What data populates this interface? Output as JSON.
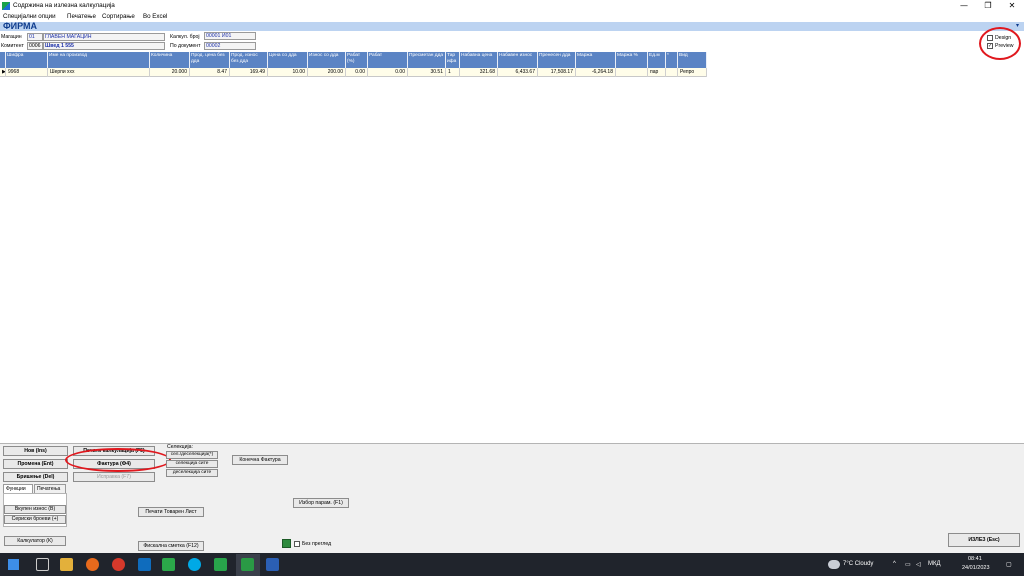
{
  "window": {
    "title": "Содржина на излезна калкулација",
    "controls": {
      "minimize": "—",
      "restore": "❐",
      "close": "✕"
    }
  },
  "menu": [
    "Специјални опции",
    "Печатење",
    "Сортирање",
    "Во Excel"
  ],
  "header": {
    "title": "ФИРМА",
    "magacin_label": "Магацин",
    "magacin_code": "01",
    "magacin_name": "ГЛАВЕН МАГАЦИН",
    "komintent_label": "Комитент",
    "komintent_code": "0006",
    "komintent_name": "Швед 1 555",
    "kalkul_label": "Калкул. број",
    "kalkul_value": "00001 И01",
    "podok_label": "По документ",
    "podok_value": "00002",
    "design_label": "Design",
    "design_checked": false,
    "preview_label": "Preview",
    "preview_checked": true
  },
  "grid": {
    "columns": [
      "Шифра",
      "Име на производ",
      "Количина",
      "Прод. цена без дда",
      "Прод. износ без дда",
      "Цена со дда",
      "Износ со дда",
      "Рабат (%)",
      "Рабат",
      "Пресметан дда",
      "Тар ифа",
      "Набавна цена",
      "Набавен износ",
      "Пренесен дда",
      "Маржа",
      "Маржа %",
      "Ед.м",
      "*",
      "Вид"
    ],
    "rows": [
      [
        "9968",
        "Шерпи ххх",
        "20.000",
        "8.47",
        "169.49",
        "10.00",
        "200.00",
        "0.00",
        "0.00",
        "30.51",
        "1",
        "321.68",
        "6,433.67",
        "17,508.17",
        "-6,264.18",
        "",
        "пар",
        "",
        "Репро"
      ]
    ]
  },
  "bottom": {
    "buttons": {
      "new": "Нов (Ins)",
      "change": "Промена (Ent)",
      "delete": "Бришење (Del)",
      "print_calc": "Печати калкулација (F5)",
      "invoice": "Фактура (Ф4)",
      "correction": "Исправка (F7)",
      "select_label": "Селекција:",
      "sel_deselect": "сел./деселекција(*)",
      "select_all": "селекција сите",
      "deselect_all": "деселекција сите",
      "final_invoice": "Конечна Фактура",
      "total_amount": "Вкупен износ (В)",
      "serial_numbers": "Сериски броеви (+)",
      "print_waybill": "Печати Товарен Лист",
      "choose_params": "Избор парам. (F1)",
      "calculator": "Калкулатор (К)",
      "fiscal_bill": "Фискална сметка (F12)",
      "no_preview": "Без преглед",
      "exit": "ИЗЛЕЗ (Esc)"
    },
    "tabs": [
      "Функции",
      "Печатења"
    ]
  },
  "taskbar": {
    "weather": "7°C  Cloudy",
    "language": "МКД",
    "time": "08:41",
    "date": "24/01/2023"
  },
  "colors": {
    "accent_blue": "#5b84c4",
    "band_blue": "#bcd3f1",
    "highlight_red": "#e0181e"
  }
}
